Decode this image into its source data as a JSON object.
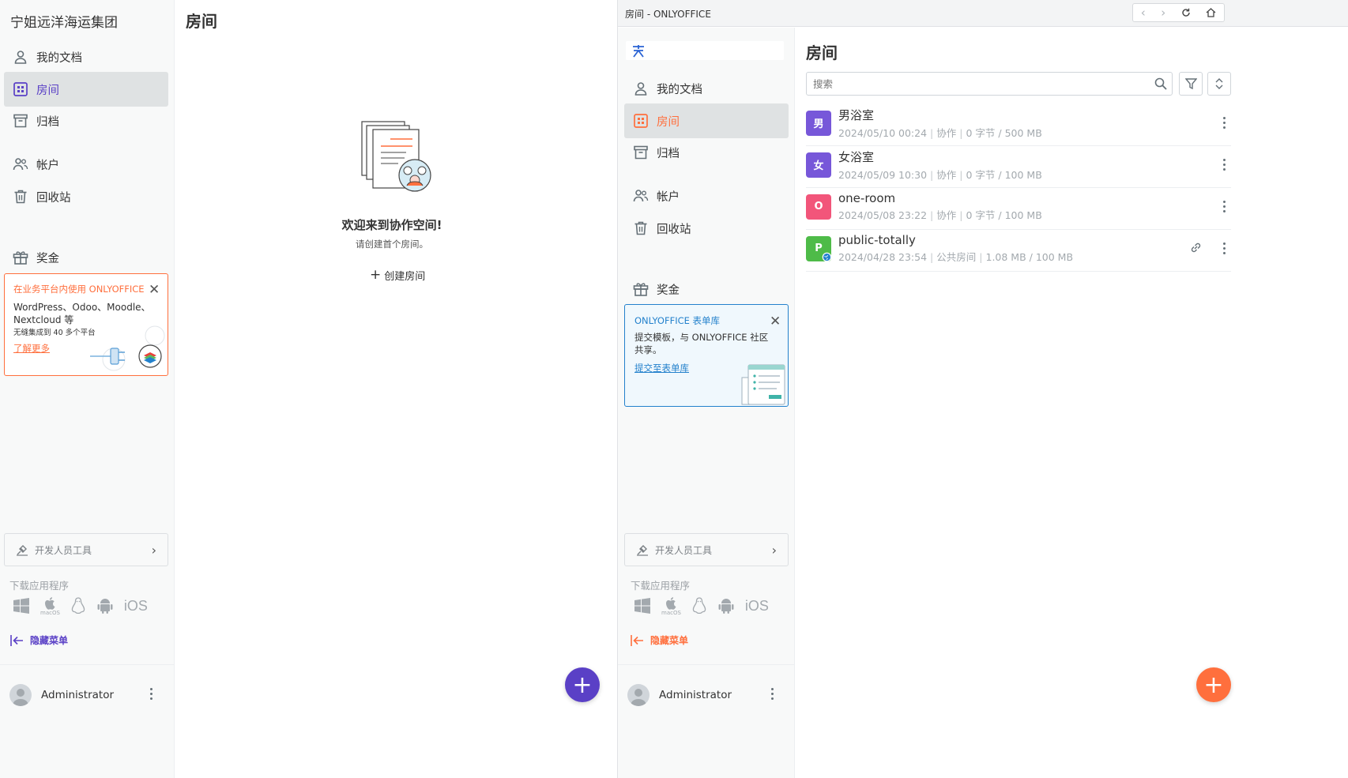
{
  "colors": {
    "accent_purple": "#5a40c6",
    "accent_orange": "#ff6f3d",
    "link_blue": "#2381cc",
    "room_purple": "#7757d9",
    "room_pink": "#f2557a",
    "room_green": "#4ebb48"
  },
  "left_panel": {
    "org_name": "宁姐远洋海运集团",
    "nav": {
      "my_documents": "我的文档",
      "rooms": "房间",
      "archive": "归档",
      "accounts": "帐户",
      "trash": "回收站",
      "bonus": "奖金"
    },
    "promo": {
      "title": "在业务平台内使用 ONLYOFFICE",
      "line1": "WordPress、Odoo、Moodle、",
      "line2": "Nextcloud 等",
      "line3": "无缝集成到 40 多个平台",
      "link": "了解更多"
    },
    "dev_tools": "开发人员工具",
    "download_label": "下载应用程序",
    "macos_caption": "macOS",
    "ios_label": "iOS",
    "hide_menu": "隐藏菜单",
    "user_name": "Administrator",
    "main_title": "房间",
    "empty_title": "欢迎来到协作空间!",
    "empty_subtitle": "请创建首个房间。",
    "create_room": "创建房间",
    "fab": "+"
  },
  "right_window": {
    "title": "房间 - ONLYOFFICE",
    "nav": {
      "my_documents": "我的文档",
      "rooms": "房间",
      "archive": "归档",
      "accounts": "帐户",
      "trash": "回收站",
      "bonus": "奖金"
    },
    "promo": {
      "title": "ONLYOFFICE 表单库",
      "body": "提交模板，与 ONLYOFFICE 社区共享。",
      "link": "提交至表单库"
    },
    "dev_tools": "开发人员工具",
    "download_label": "下载应用程序",
    "macos_caption": "macOS",
    "ios_label": "iOS",
    "hide_menu": "隐藏菜单",
    "user_name": "Administrator",
    "main_title": "房间",
    "search_placeholder": "搜索",
    "rooms": [
      {
        "letter": "男",
        "name": "男浴室",
        "date": "2024/05/10 00:24",
        "type": "协作",
        "size": "0 字节 / 500 MB"
      },
      {
        "letter": "女",
        "name": "女浴室",
        "date": "2024/05/09 10:30",
        "type": "协作",
        "size": "0 字节 / 100 MB"
      },
      {
        "letter": "O",
        "name": "one-room",
        "date": "2024/05/08 23:22",
        "type": "协作",
        "size": "0 字节 / 100 MB"
      },
      {
        "letter": "P",
        "name": "public-totally",
        "date": "2024/04/28 23:54",
        "type": "公共房间",
        "size": "1.08 MB / 100 MB"
      }
    ],
    "fab": "+"
  }
}
